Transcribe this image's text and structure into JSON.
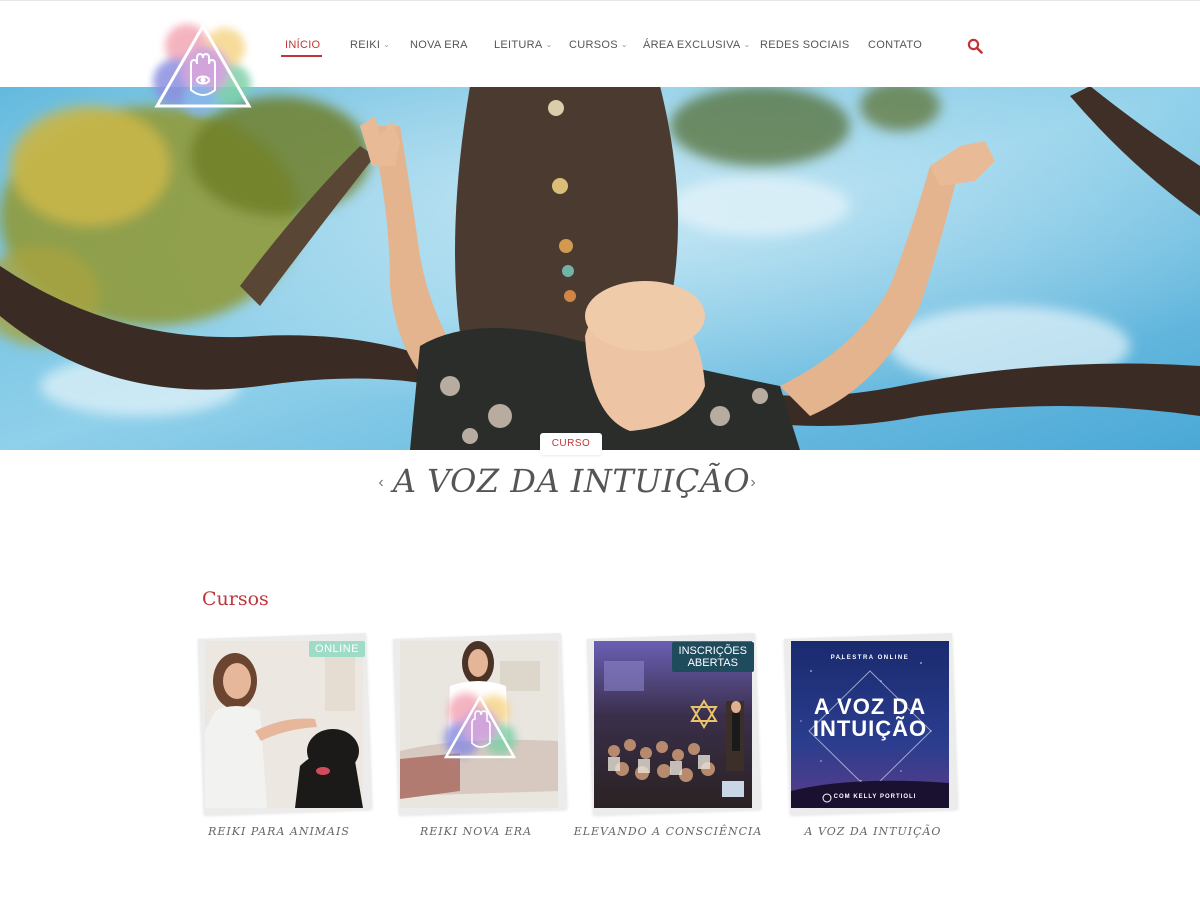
{
  "nav": {
    "items": [
      {
        "label": "INÍCIO",
        "active": true
      },
      {
        "label": "REIKI"
      },
      {
        "label": "NOVA ERA"
      },
      {
        "label": "LEITURA"
      },
      {
        "label": "CURSOS"
      },
      {
        "label": "ÁREA EXCLUSIVA"
      },
      {
        "label": "REDES SOCIAIS"
      },
      {
        "label": "CONTATO"
      }
    ],
    "search_icon": "search-icon"
  },
  "hero": {
    "badge": "CURSO",
    "title": "A VOZ DA INTUIÇÃO",
    "prev_icon": "chevron-left-icon",
    "next_icon": "chevron-right-icon"
  },
  "courses": {
    "title": "Cursos",
    "items": [
      {
        "label": "REIKI PARA ANIMAIS",
        "tag": "ONLINE"
      },
      {
        "label": "REIKI NOVA ERA"
      },
      {
        "label": "ELEVANDO A CONSCIÊNCIA",
        "tag_line1": "INSCRIÇÕES",
        "tag_line2": "ABERTAS"
      },
      {
        "label": "A VOZ DA INTUIÇÃO",
        "poster_top": "PALESTRA ONLINE",
        "poster_title_line1": "A VOZ DA",
        "poster_title_line2": "INTUIÇÃO",
        "poster_bottom": "COM KELLY PORTIOLI"
      }
    ]
  },
  "colors": {
    "accent": "#c0353a",
    "tag_online": "#9fdcc7",
    "tag_open": "#1e4c5c"
  }
}
